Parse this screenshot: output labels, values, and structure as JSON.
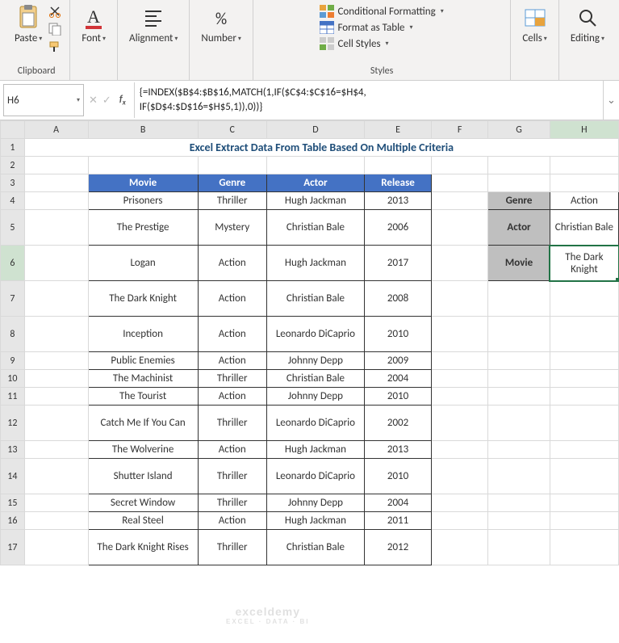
{
  "ribbon": {
    "clipboard": {
      "label": "Clipboard",
      "paste": "Paste"
    },
    "font": {
      "label": "Font"
    },
    "alignment": {
      "label": "Alignment"
    },
    "number": {
      "label": "Number"
    },
    "styles": {
      "label": "Styles",
      "conditional": "Conditional Formatting",
      "format_table": "Format as Table",
      "cell_styles": "Cell Styles"
    },
    "cells": {
      "label": "Cells"
    },
    "editing": {
      "label": "Editing"
    }
  },
  "formula_bar": {
    "cell_ref": "H6",
    "formula": "{=INDEX($B$4:$B$16,MATCH(1,IF($C$4:$C$16=$H$4,\nIF($D$4:$D$16=$H$5,1)),0))}"
  },
  "columns": [
    "A",
    "B",
    "C",
    "D",
    "E",
    "F",
    "G",
    "H"
  ],
  "title": "Excel Extract Data From Table Based On Multiple Criteria",
  "table": {
    "headers": [
      "Movie",
      "Genre",
      "Actor",
      "Release"
    ],
    "rows": [
      {
        "movie": "Prisoners",
        "genre": "Thriller",
        "actor": "Hugh Jackman",
        "release": "2013"
      },
      {
        "movie": "The Prestige",
        "genre": "Mystery",
        "actor": "Christian Bale",
        "release": "2006"
      },
      {
        "movie": "Logan",
        "genre": "Action",
        "actor": "Hugh Jackman",
        "release": "2017"
      },
      {
        "movie": "The Dark Knight",
        "genre": "Action",
        "actor": "Christian Bale",
        "release": "2008"
      },
      {
        "movie": "Inception",
        "genre": "Action",
        "actor": "Leonardo DiCaprio",
        "release": "2010"
      },
      {
        "movie": "Public Enemies",
        "genre": "Action",
        "actor": "Johnny Depp",
        "release": "2009"
      },
      {
        "movie": "The Machinist",
        "genre": "Thriller",
        "actor": "Christian Bale",
        "release": "2004"
      },
      {
        "movie": "The Tourist",
        "genre": "Action",
        "actor": "Johnny Depp",
        "release": "2010"
      },
      {
        "movie": "Catch Me If You Can",
        "genre": "Thriller",
        "actor": "Leonardo DiCaprio",
        "release": "2002"
      },
      {
        "movie": "The Wolverine",
        "genre": "Action",
        "actor": "Hugh Jackman",
        "release": "2013"
      },
      {
        "movie": "Shutter Island",
        "genre": "Thriller",
        "actor": "Leonardo DiCaprio",
        "release": "2010"
      },
      {
        "movie": "Secret Window",
        "genre": "Thriller",
        "actor": "Johnny Depp",
        "release": "2004"
      },
      {
        "movie": "Real Steel",
        "genre": "Action",
        "actor": "Hugh Jackman",
        "release": "2011"
      },
      {
        "movie": "The Dark Knight Rises",
        "genre": "Thriller",
        "actor": "Christian Bale",
        "release": "2012"
      }
    ]
  },
  "lookup": {
    "genre_label": "Genre",
    "genre_value": "Action",
    "actor_label": "Actor",
    "actor_value": "Christian Bale",
    "movie_label": "Movie",
    "movie_value": "The Dark Knight"
  },
  "row_heights_tall": [
    5,
    6,
    7,
    8,
    12,
    14,
    17
  ],
  "watermark": "exceldemy"
}
